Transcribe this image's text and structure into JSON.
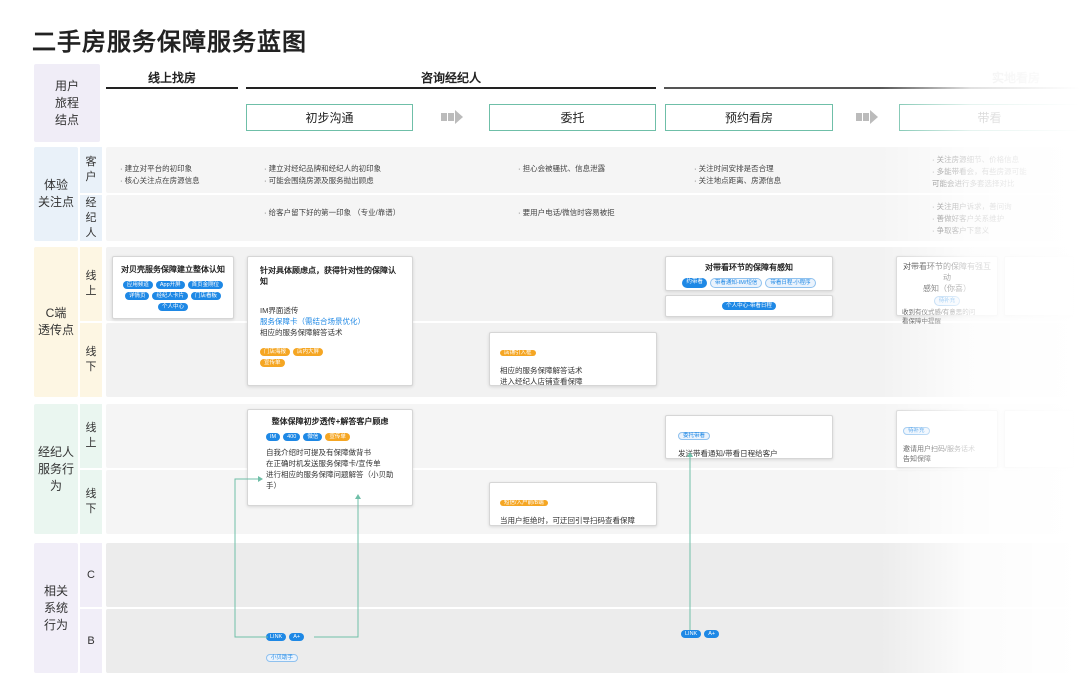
{
  "title": "二手房服务保障服务蓝图",
  "rows": {
    "journey": "用户\n旅程\n结点",
    "experience": "体验\n关注点",
    "c_end": "C端\n透传点",
    "agent": "经纪人\n服务行为",
    "system": "相关\n系统\n行为"
  },
  "sub": {
    "customer": "客\n户",
    "agent": "经\n纪\n人",
    "online": "线\n上",
    "offline": "线\n下",
    "c": "C",
    "b": "B"
  },
  "phases": {
    "online_search": "线上找房",
    "consult": "咨询经纪人",
    "onsite": "实地看房"
  },
  "steps": {
    "initial": "初步沟通",
    "entrust": "委托",
    "booking": "预约看房",
    "showing": "带看"
  },
  "experience": {
    "c1": "· 建立对平台的初印象\n· 核心关注点在房源信息",
    "c2": "· 建立对经纪品牌和经纪人的初印象\n· 可能会围绕房源及服务抛出顾虑",
    "c3": "· 担心会被骚扰、信息泄露",
    "c4": "· 关注时间安排是否合理\n· 关注地点距离、房源信息",
    "c5": "· 关注房源细节、价格信息\n· 多能带看会，有些房源可能\n  可能会进行多套选择对比",
    "a2": "· 给客户留下好的第一印象 （专业/靠谱）",
    "a3": "· 要用户电话/微信时容易被拒",
    "a5": "· 关注用户诉求，善问询\n· 善做好客户关系维护\n· 争取客户下意义"
  },
  "c_online": {
    "card1": {
      "title": "对贝壳服务保障建立整体认知",
      "chips": [
        "应用频道",
        "App开屏",
        "首页金刚位",
        "详情页",
        "经纪人卡片",
        "门店看板",
        "个人中心"
      ]
    },
    "card2": {
      "title": "针对具体顾虑点，获得针对性的保障认知",
      "line1": "IM界面透传",
      "line2": "服务保障卡（需结合场景优化）",
      "line3": "相应的服务保障解答话术",
      "chips": [
        "门店海报",
        "店内大屏",
        "宣传单"
      ]
    },
    "card4": {
      "title": "对带看环节的保障有感知",
      "chips": [
        "约带看",
        "带看通知-IM/短信",
        "带看日程-小程序"
      ]
    },
    "card4b": {
      "chips": [
        "个人中心-带看日程"
      ]
    },
    "card5": {
      "title": "对带看环节的保障有强互动\n感知（你喜）",
      "text": "收到有仪式感/有意思的问\n看保障中提醒",
      "chips": [
        "待补充"
      ]
    }
  },
  "c_offline": {
    "card3": {
      "chip": "店铺引入框",
      "text": "相应的服务保障解答话术\n进入经纪人店铺查看保障"
    }
  },
  "agent_online": {
    "card1": {
      "title": "整体保障初步透传+解答客户顾虑",
      "chips": [
        "IM",
        "400",
        "微信",
        "宣传单"
      ],
      "text": "自我介绍时可提及有保障做背书\n在正确时机发送服务保障卡/宣传单\n进行相应的服务保障问题解答（小贝助手）"
    },
    "card2": {
      "chip": "委托带看",
      "text": "发送带看通知/带看日程给客户"
    },
    "card3": {
      "chip": "待补充",
      "text": "邀请用户扫码/服务话术\n告知保障"
    }
  },
  "agent_offline": {
    "card1": {
      "chip": "短信/入户前/B端",
      "text": "当用户拒绝时，可迂回引导扫码查看保障"
    }
  },
  "system": {
    "b_chips1": [
      "LINK",
      "A+"
    ],
    "b_chip_helper": "小贝助手",
    "b_chips2": [
      "LINK",
      "A+"
    ]
  },
  "colors": {
    "journey_label": "#f0edf7",
    "experience_label": "#e9f1f9",
    "c_label": "#fdf6e3",
    "agent_label": "#eaf6f0",
    "system_label": "#f1eef8",
    "band_light": "#f5f5f5",
    "band_dark": "#ececec",
    "accent_green": "#6fbfa8",
    "chip_blue": "#1e88e5",
    "chip_orange": "#f5a623"
  }
}
